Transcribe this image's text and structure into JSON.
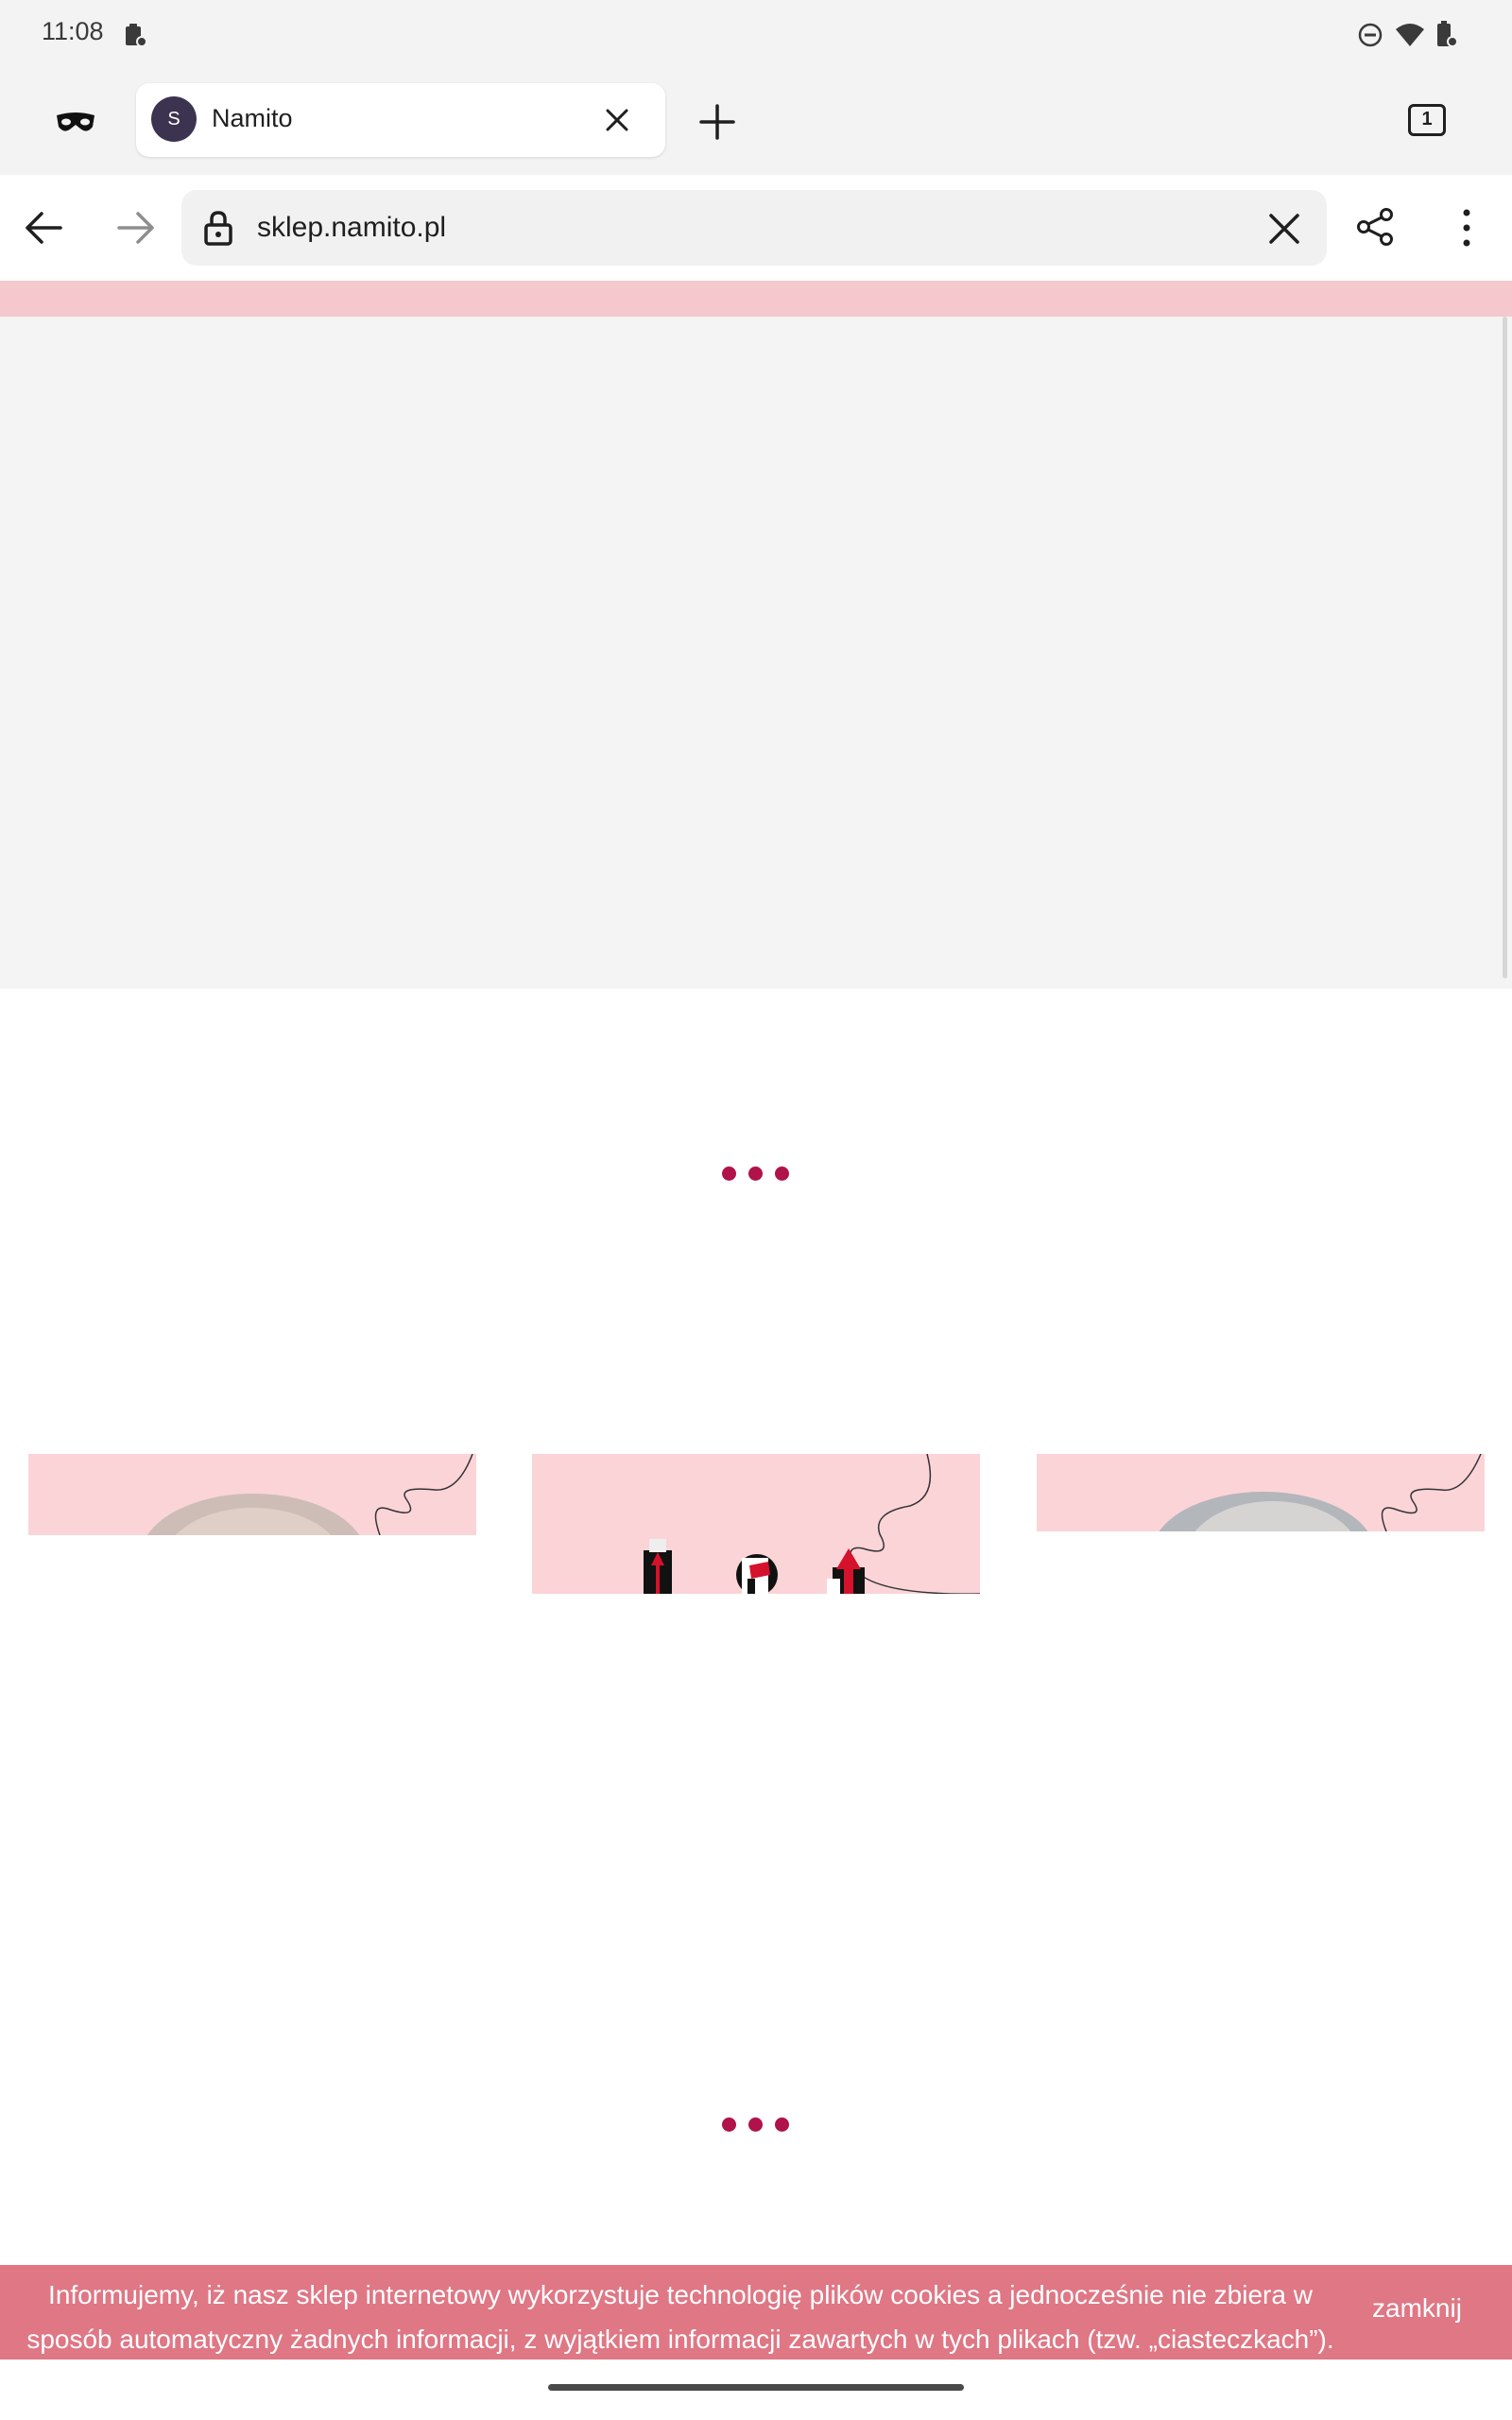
{
  "status_bar": {
    "time": "11:08",
    "left_icons": [
      "clipboard-icon"
    ],
    "right_icons": [
      "do-not-disturb-icon",
      "wifi-icon",
      "battery-icon"
    ]
  },
  "browser": {
    "incognito_icon": "incognito-mask-icon",
    "tab": {
      "favicon_letter": "S",
      "title": "Namito",
      "close_icon": "close-icon"
    },
    "new_tab_icon": "plus-icon",
    "tab_count": "1",
    "url": "sklep.namito.pl",
    "toolbar_icons": [
      "back-arrow-icon",
      "forward-arrow-icon",
      "lock-icon",
      "clear-icon",
      "share-icon",
      "more-vert-icon"
    ]
  },
  "page": {
    "loading_indicator_icon": "loading-dots-icon",
    "cards": [
      {
        "name": "promo-card-face"
      },
      {
        "name": "promo-card-products"
      },
      {
        "name": "promo-card-portrait"
      }
    ]
  },
  "cookie_banner": {
    "text": "Informujemy, iż nasz sklep internetowy wykorzystuje technologię plików cookies a jednocześnie nie zbiera w sposób automatyczny żadnych informacji, z wyjątkiem informacji zawartych w tych plikach (tzw. „ciasteczkach”).",
    "close_label": "zamknij"
  },
  "colors": {
    "accent": "#b0124a",
    "banner": "#db6474",
    "pink": "#f5c8ce"
  }
}
